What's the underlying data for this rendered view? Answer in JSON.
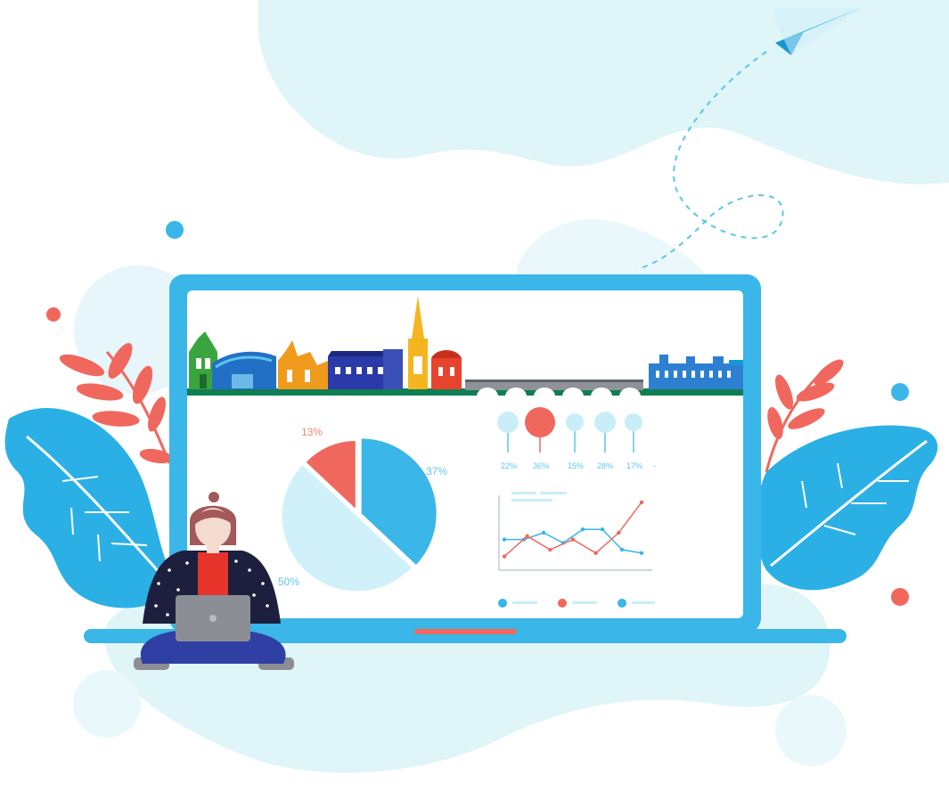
{
  "colors": {
    "blob_light": "#d9f4f8",
    "blob_lighter": "#e9f8fb",
    "brand_blue": "#3ab6e8",
    "deep_blue": "#1596d6",
    "red": "#f0685d",
    "pale_blue": "#c9eef8",
    "label_blue": "#5cc6ea",
    "label_orange": "#f18a6d",
    "pants": "#2f3fa3",
    "jacket": "#1c1f3e",
    "hair": "#a3585a",
    "skin": "#f4dbcf",
    "laptop_small": "#8b8e94"
  },
  "illustration": {
    "icons": {
      "paper_plane": "paper-plane-icon",
      "bridge": "bridge-icon",
      "skyline": "city-skyline-icon",
      "leaf": "leaf-icon",
      "person": "person-with-laptop-icon"
    },
    "pie": {
      "slices": [
        {
          "label": "13%",
          "value": 13,
          "color": "#f0685d"
        },
        {
          "label": "37%",
          "value": 37,
          "color": "#3ab6e8"
        },
        {
          "label": "50%",
          "value": 50,
          "color": "#d0f1f9"
        }
      ]
    },
    "bubbles": [
      {
        "label": "22%",
        "value": 22
      },
      {
        "label": "36%",
        "value": 36
      },
      {
        "label": "15%",
        "value": 15
      },
      {
        "label": "28%",
        "value": 28
      },
      {
        "label": "17%",
        "value": 17
      }
    ],
    "line_chart": {
      "red_series": [
        0.15,
        0.45,
        0.25,
        0.4,
        0.2,
        0.5,
        0.95
      ],
      "blue_series": [
        0.4,
        0.4,
        0.5,
        0.35,
        0.55,
        0.55,
        0.25,
        0.2
      ]
    }
  }
}
